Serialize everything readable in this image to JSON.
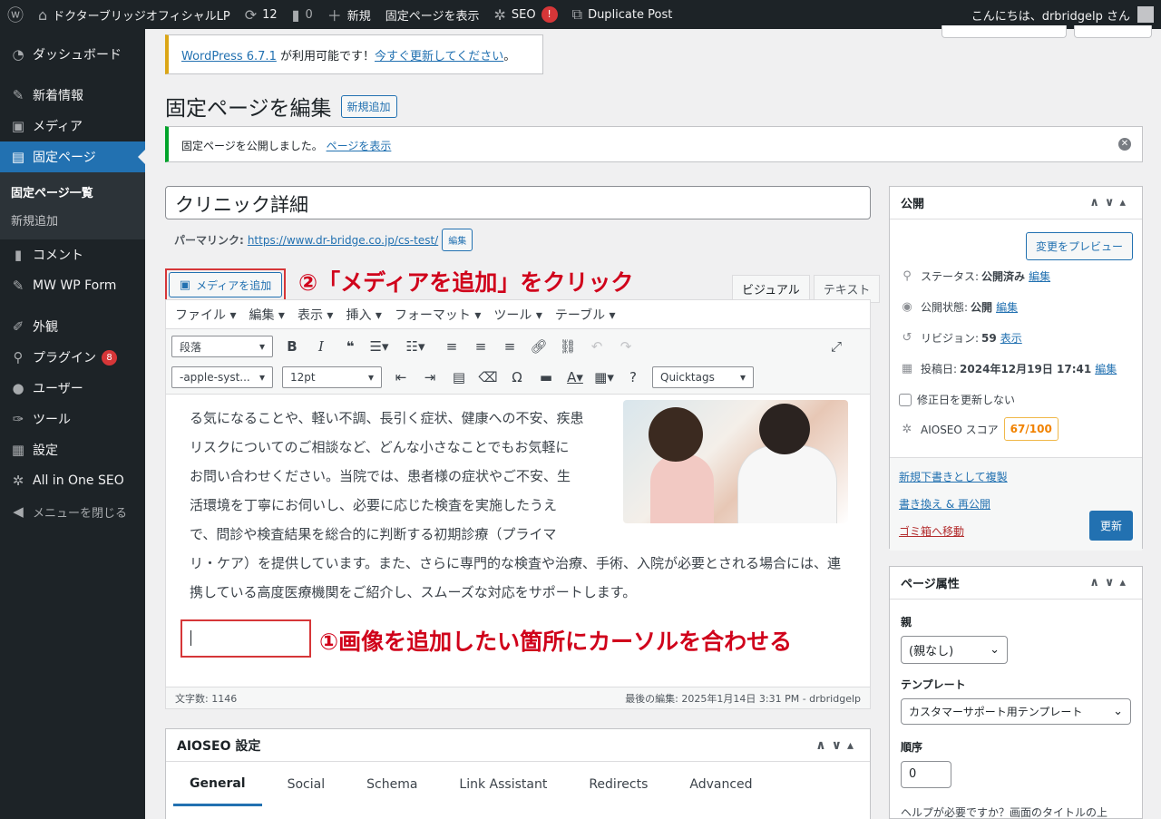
{
  "adminbar": {
    "site_name": "ドクターブリッジオフィシャルLP",
    "updates_count": "12",
    "comments_count": "0",
    "new_label": "新規",
    "view_page": "固定ページを表示",
    "seo_label": "SEO",
    "seo_badge": "!",
    "duplicate_post": "Duplicate Post",
    "greeting": "こんにちは、drbridgelp さん"
  },
  "sidebar": {
    "items": [
      {
        "label": "ダッシュボード",
        "icon": "dashboard-icon"
      },
      {
        "label": "新着情報",
        "icon": "pin-icon"
      },
      {
        "label": "メディア",
        "icon": "media-icon"
      },
      {
        "label": "固定ページ",
        "icon": "page-icon"
      },
      {
        "label": "コメント",
        "icon": "comment-icon"
      },
      {
        "label": "MW WP Form",
        "icon": "pin-icon"
      },
      {
        "label": "外観",
        "icon": "appearance-icon"
      },
      {
        "label": "プラグイン",
        "icon": "plugin-icon",
        "badge": "8"
      },
      {
        "label": "ユーザー",
        "icon": "user-icon"
      },
      {
        "label": "ツール",
        "icon": "wrench-icon"
      },
      {
        "label": "設定",
        "icon": "settings-icon"
      },
      {
        "label": "All in One SEO",
        "icon": "gear-icon"
      },
      {
        "label": "メニューを閉じる",
        "icon": "collapse-icon"
      }
    ],
    "submenu": [
      "固定ページ一覧",
      "新規追加"
    ]
  },
  "notices": {
    "update_link": "WordPress 6.7.1",
    "update_text": " が利用可能です！",
    "update_now": "今すぐ更新してください",
    "update_end": "。",
    "published_text": "固定ページを公開しました。",
    "view_page_link": "ページを表示"
  },
  "heading": {
    "title": "固定ページを編集",
    "add_new": "新規追加"
  },
  "post": {
    "title": "クリニック詳細",
    "permalink_label": "パーマリンク:",
    "permalink_url": "https://www.dr-bridge.co.jp/cs-test/",
    "edit_button": "編集"
  },
  "annotations": {
    "step2": "②「メディアを追加」をクリック",
    "step1": "①画像を追加したい箇所にカーソルを合わせる"
  },
  "editor": {
    "add_media": "メディアを追加",
    "tab_visual": "ビジュアル",
    "tab_text": "テキスト",
    "menu": [
      "ファイル ▾",
      "編集 ▾",
      "表示 ▾",
      "挿入 ▾",
      "フォーマット ▾",
      "ツール ▾",
      "テーブル ▾"
    ],
    "format_select": "段落",
    "font_select": "-apple-syst...",
    "size_select": "12pt",
    "quicktags": "Quicktags",
    "content_lines": [
      "る気になることや、軽い不調、長引く症状、健康への不安、疾患",
      "リスクについてのご相談など、どんな小さなことでもお気軽に",
      "お問い合わせください。当院では、患者様の症状やご不安、生",
      "活環境を丁寧にお伺いし、必要に応じた検査を実施したうえ",
      "で、問診や検査結果を総合的に判断する初期診療（プライマ",
      "リ・ケア）を提供しています。また、さらに専門的な検査や治療、手術、入院が必要とされる場合には、連",
      "携している高度医療機関をご紹介し、スムーズな対応をサポートします。"
    ],
    "word_count": "文字数: 1146",
    "last_edited": "最後の編集: 2025年1月14日 3:31 PM - drbridgelp"
  },
  "aioseo": {
    "title": "AIOSEO 設定",
    "tabs": [
      "General",
      "Social",
      "Schema",
      "Link Assistant",
      "Redirects",
      "Advanced"
    ]
  },
  "publish_box": {
    "title": "公開",
    "preview": "変更をプレビュー",
    "status_label": "ステータス:",
    "status_value": "公開済み",
    "visibility_label": "公開状態:",
    "visibility_value": "公開",
    "revisions_label": "リビジョン:",
    "revisions_value": "59",
    "revisions_link": "表示",
    "date_label": "投稿日:",
    "date_value": "2024年12月19日 17:41",
    "edit": "編集",
    "no_update_date": "修正日を更新しない",
    "aioseo_label": "AIOSEO スコア",
    "aioseo_score": "67/100",
    "copy_draft": "新規下書きとして複製",
    "rewrite": "書き換え & 再公開",
    "trash": "ゴミ箱へ移動",
    "update": "更新"
  },
  "attributes_box": {
    "title": "ページ属性",
    "parent_label": "親",
    "parent_value": "(親なし)",
    "template_label": "テンプレート",
    "template_value": "カスタマーサポート用テンプレート",
    "order_label": "順序",
    "order_value": "0",
    "help": "ヘルプが必要ですか？画面のタイトルの上"
  }
}
